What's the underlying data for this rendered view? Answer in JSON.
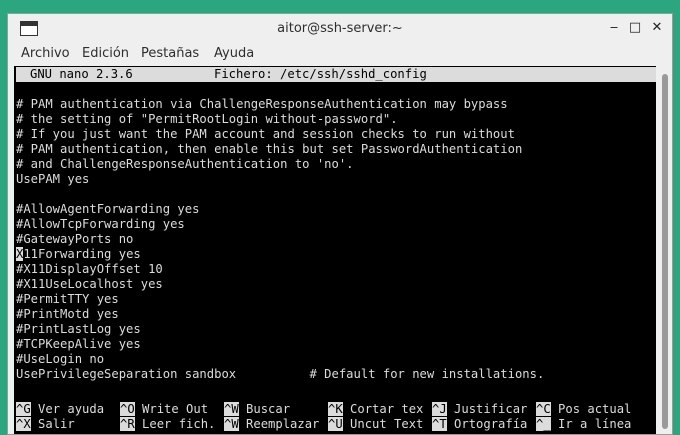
{
  "window": {
    "title": "aitor@ssh-server:~",
    "minimize_glyph": "‒",
    "maximize_glyph": "□",
    "close_glyph": "✕"
  },
  "menu": [
    "Archivo",
    "Edición",
    "Pestañas",
    "Ayuda"
  ],
  "nano": {
    "version": "GNU nano 2.3.6",
    "file_label": "Fichero: /etc/ssh/sshd_config"
  },
  "editor": {
    "lines": [
      "# PAM authentication via ChallengeResponseAuthentication may bypass",
      "# the setting of \"PermitRootLogin without-password\".",
      "# If you just want the PAM account and session checks to run without",
      "# PAM authentication, then enable this but set PasswordAuthentication",
      "# and ChallengeResponseAuthentication to 'no'.",
      "UsePAM yes",
      "",
      "#AllowAgentForwarding yes",
      "#AllowTcpForwarding yes",
      "#GatewayPorts no",
      "11Forwarding yes",
      "#X11DisplayOffset 10",
      "#X11UseLocalhost yes",
      "#PermitTTY yes",
      "#PrintMotd yes",
      "#PrintLastLog yes",
      "#TCPKeepAlive yes",
      "#UseLogin no",
      "UsePrivilegeSeparation sandbox          # Default for new installations."
    ],
    "cursor_char": "X"
  },
  "shortcuts": {
    "row1": [
      {
        "key": "^G",
        "label": " Ver ayuda"
      },
      {
        "key": "^O",
        "label": " Write Out"
      },
      {
        "key": "^W",
        "label": " Buscar"
      },
      {
        "key": "^K",
        "label": " Cortar tex"
      },
      {
        "key": "^J",
        "label": " Justificar"
      },
      {
        "key": "^C",
        "label": " Pos actual"
      }
    ],
    "row2": [
      {
        "key": "^X",
        "label": " Salir"
      },
      {
        "key": "^R",
        "label": " Leer fich."
      },
      {
        "key": "^W",
        "label": " Reemplazar"
      },
      {
        "key": "^U",
        "label": " Uncut Text"
      },
      {
        "key": "^T",
        "label": " Ortografía"
      },
      {
        "key": "^_",
        "label": " Ir a línea"
      }
    ]
  }
}
